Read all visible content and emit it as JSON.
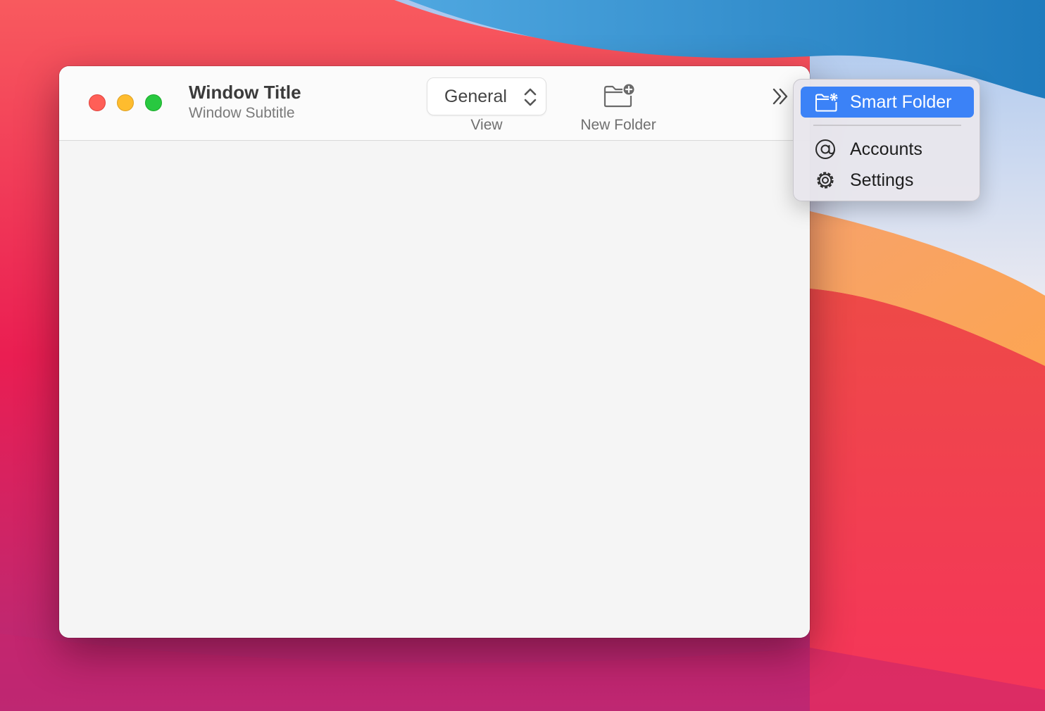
{
  "window": {
    "title": "Window Title",
    "subtitle": "Window Subtitle",
    "traffic_lights": {
      "close_color": "#ff5f57",
      "minimize_color": "#febc2e",
      "zoom_color": "#28c840"
    }
  },
  "toolbar": {
    "view_popup": {
      "value": "General",
      "label": "View",
      "icon": "chevron-up-down-icon"
    },
    "new_folder": {
      "label": "New Folder",
      "icon": "folder-badge-plus-icon"
    },
    "overflow": {
      "icon": "chevron-double-right-icon"
    }
  },
  "overflow_menu": {
    "items": [
      {
        "label": "Smart Folder",
        "icon": "folder-gear-icon",
        "selected": true
      },
      {
        "label": "Accounts",
        "icon": "at-sign-icon",
        "selected": false
      },
      {
        "label": "Settings",
        "icon": "gear-icon",
        "selected": false
      }
    ],
    "accent_color": "#3b82f7"
  }
}
